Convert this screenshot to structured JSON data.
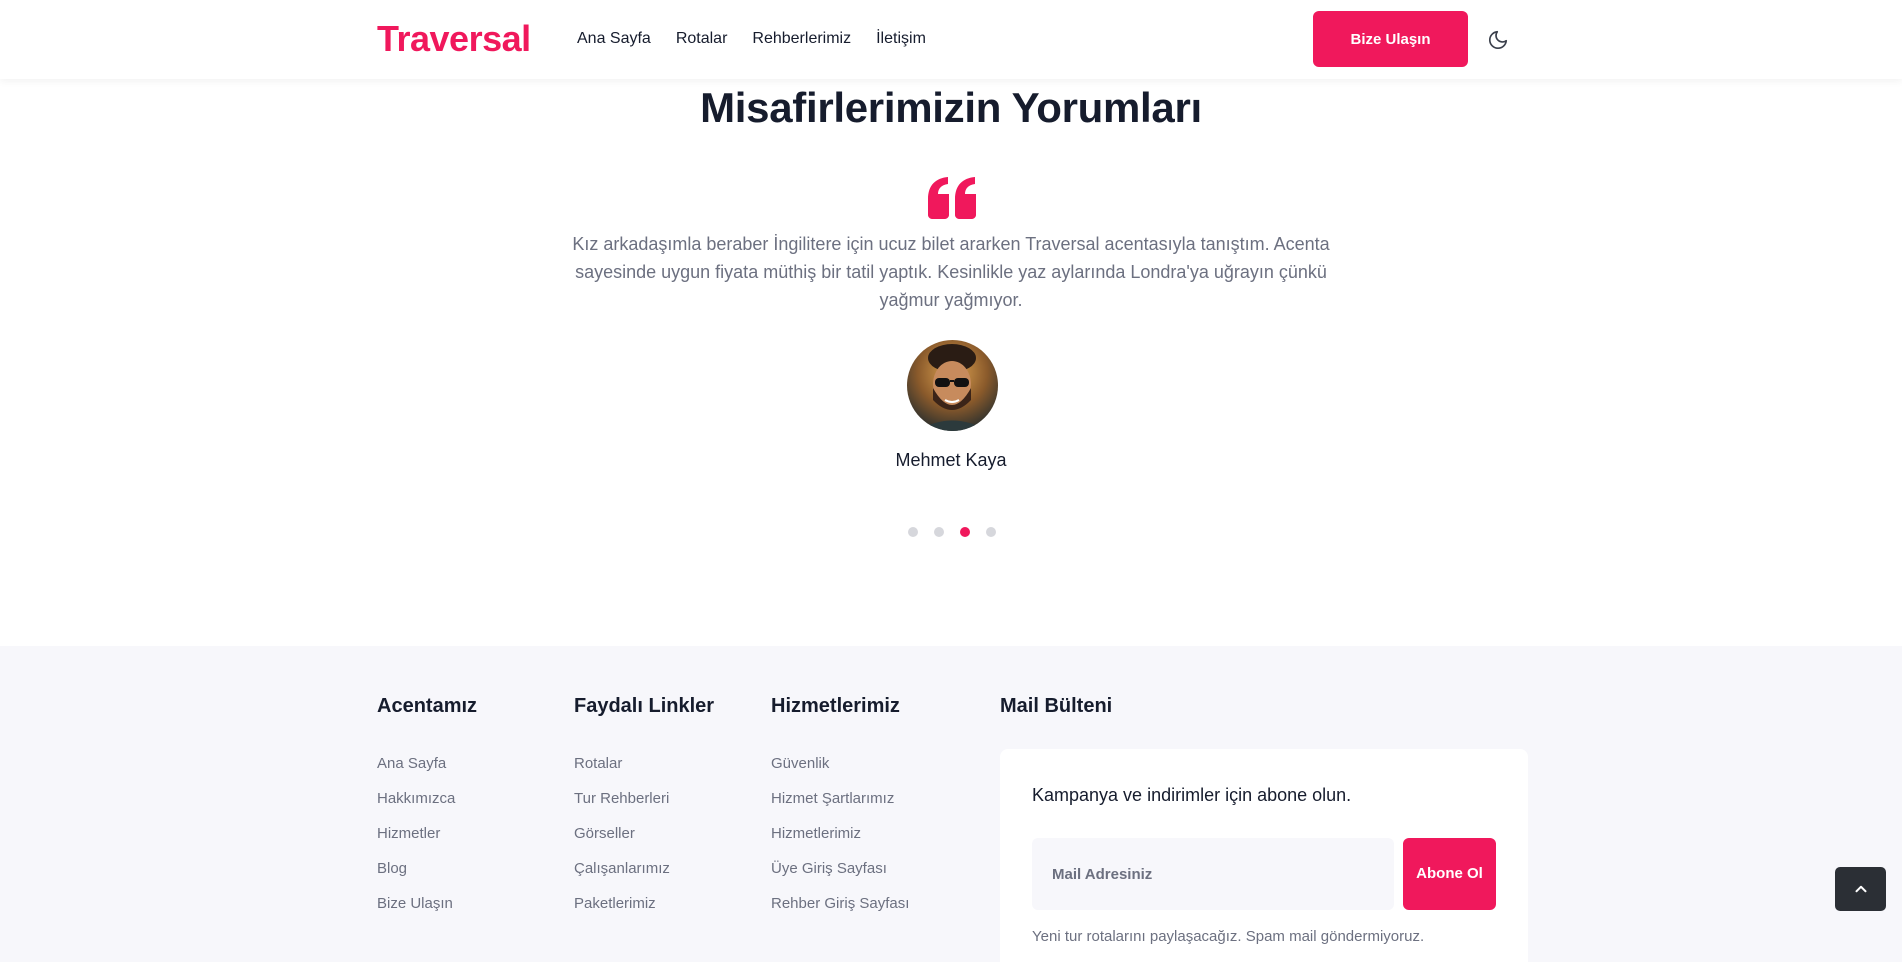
{
  "header": {
    "logo": "Traversal",
    "nav": [
      "Ana Sayfa",
      "Rotalar",
      "Rehberlerimiz",
      "İletişim"
    ],
    "cta_label": "Bize Ulaşın",
    "theme_icon": "moon-icon"
  },
  "testimonials": {
    "title": "Misafirlerimizin Yorumları",
    "quote_icon": "quote-icon",
    "text": "Kız arkadaşımla beraber İngilitere için ucuz bilet ararken Traversal acentasıyla tanıştım. Acenta sayesinde uygun fiyata müthiş bir tatil yaptık. Kesinlikle yaz aylarında Londra'ya uğrayın çünkü yağmur yağmıyor.",
    "author": "Mehmet Kaya",
    "slide_count": 4,
    "active_slide": 3
  },
  "footer": {
    "col1": {
      "title": "Acentamız",
      "links": [
        "Ana Sayfa",
        "Hakkımızca",
        "Hizmetler",
        "Blog",
        "Bize Ulaşın"
      ]
    },
    "col2": {
      "title": "Faydalı Linkler",
      "links": [
        "Rotalar",
        "Tur Rehberleri",
        "Görseller",
        "Çalışanlarımız",
        "Paketlerimiz"
      ]
    },
    "col3": {
      "title": "Hizmetlerimiz",
      "links": [
        "Güvenlik",
        "Hizmet Şartlarımız",
        "Hizmetlerimiz",
        "Üye Giriş Sayfası",
        "Rehber Giriş Sayfası"
      ]
    },
    "newsletter": {
      "title": "Mail Bülteni",
      "lead": "Kampanya ve indirimler için abone olun.",
      "placeholder": "Mail Adresiniz",
      "button": "Abone Ol",
      "note": "Yeni tur rotalarını paylaşacağız. Spam mail göndermiyoruz."
    }
  },
  "scroll_top_icon": "chevron-up-icon",
  "colors": {
    "accent": "#f0185c",
    "text": "#161c2d",
    "muted": "#6c7080",
    "footer_bg": "#f7f7fb",
    "scroll_btn": "#2b2f35"
  }
}
